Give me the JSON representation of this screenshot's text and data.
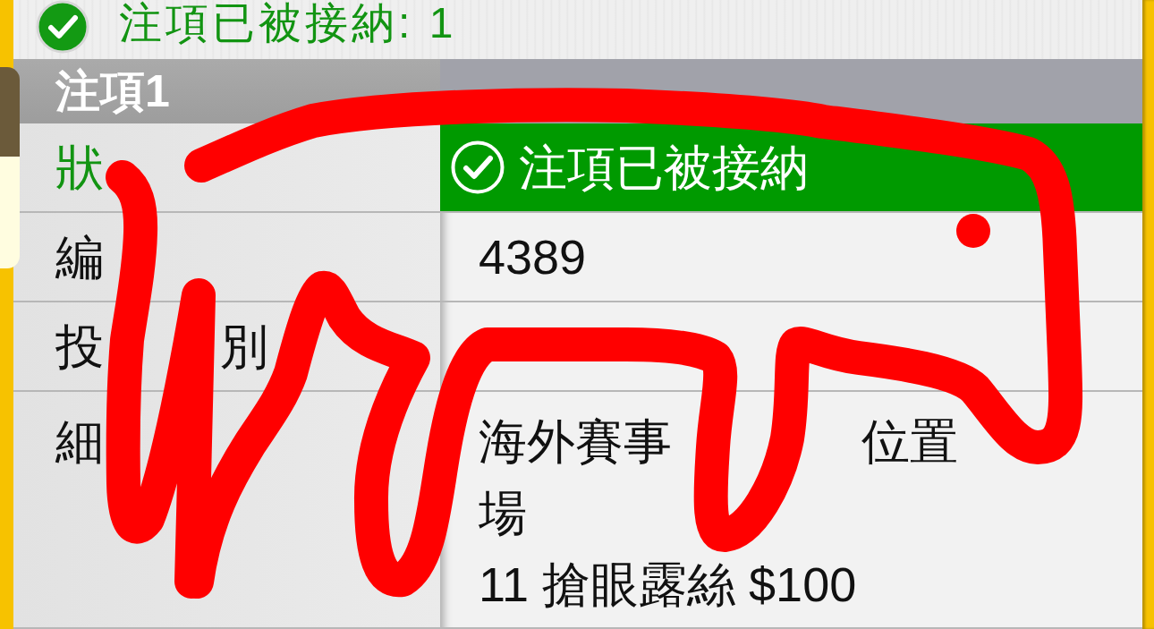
{
  "banner": {
    "accepted": true,
    "text": "注項已被接納: 1"
  },
  "bet": {
    "title": "注項1",
    "rows": [
      {
        "kind": "status",
        "label": [
          "狀"
        ],
        "accepted": true,
        "value": "注項已被接納"
      },
      {
        "kind": "text",
        "label": [
          "編"
        ],
        "value": "4389"
      },
      {
        "kind": "text",
        "label": [
          "投",
          "別"
        ]
      },
      {
        "kind": "lines",
        "label": [
          "細"
        ],
        "lines": [
          {
            "parts": [
              "海外賽事",
              "位置"
            ]
          },
          {
            "parts": [
              "場"
            ]
          },
          {
            "parts": [
              "11 搶眼露絲 $100"
            ]
          }
        ]
      }
    ]
  }
}
